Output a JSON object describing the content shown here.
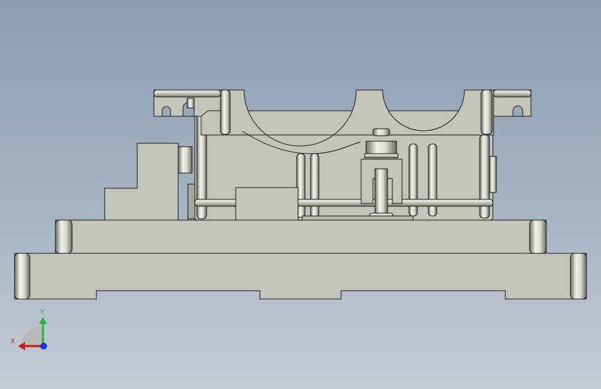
{
  "viewport": {
    "background_top": "#8b9db3",
    "background_bottom": "#c4ccd5",
    "part_color": "#c4c4bb",
    "edge_color": "#1a1a1a"
  },
  "triad": {
    "x_label": "X",
    "y_label": "Y",
    "x_color": "#d01818",
    "y_color": "#1fb83a",
    "z_color": "#1a33e0"
  }
}
